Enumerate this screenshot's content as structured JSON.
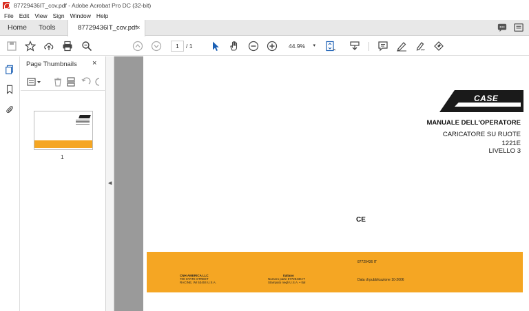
{
  "window": {
    "title": "87729436IT_cov.pdf - Adobe Acrobat Pro DC (32-bit)"
  },
  "menu": [
    "File",
    "Edit",
    "View",
    "Sign",
    "Window",
    "Help"
  ],
  "tabs": {
    "home": "Home",
    "tools": "Tools",
    "document": "87729436IT_cov.pdf",
    "close": "×"
  },
  "toolbar": {
    "page_current": "1",
    "page_total": "/ 1",
    "zoom": "44.9%",
    "zoom_caret": "▾"
  },
  "thumbnails": {
    "title": "Page Thumbnails",
    "close": "×",
    "pages": [
      {
        "label": "1"
      }
    ]
  },
  "document": {
    "logo_text": "CASE",
    "heading": "MANUALE DELL'OPERATORE",
    "subheading": "CARICATORE SU RUOTE",
    "model": "1221E",
    "level": "LIVELLO 3",
    "ce_mark": "CE",
    "band": {
      "code": "87729436 IT",
      "publisher_name": "CNH AMERICA LLC",
      "publisher_address": "700 STATE STREET",
      "publisher_city": "RACINE, WI 53404   U.S.A.",
      "edition_label": "Italiano",
      "edition_number": "Numero parte 87729436 IT",
      "edition_print": "Stampato negli U.S.A. • Ital",
      "date": "Data di pubblicazione 10-2006"
    }
  },
  "colors": {
    "band": "#f5a623",
    "doc_bg": "#9a9a9a"
  }
}
